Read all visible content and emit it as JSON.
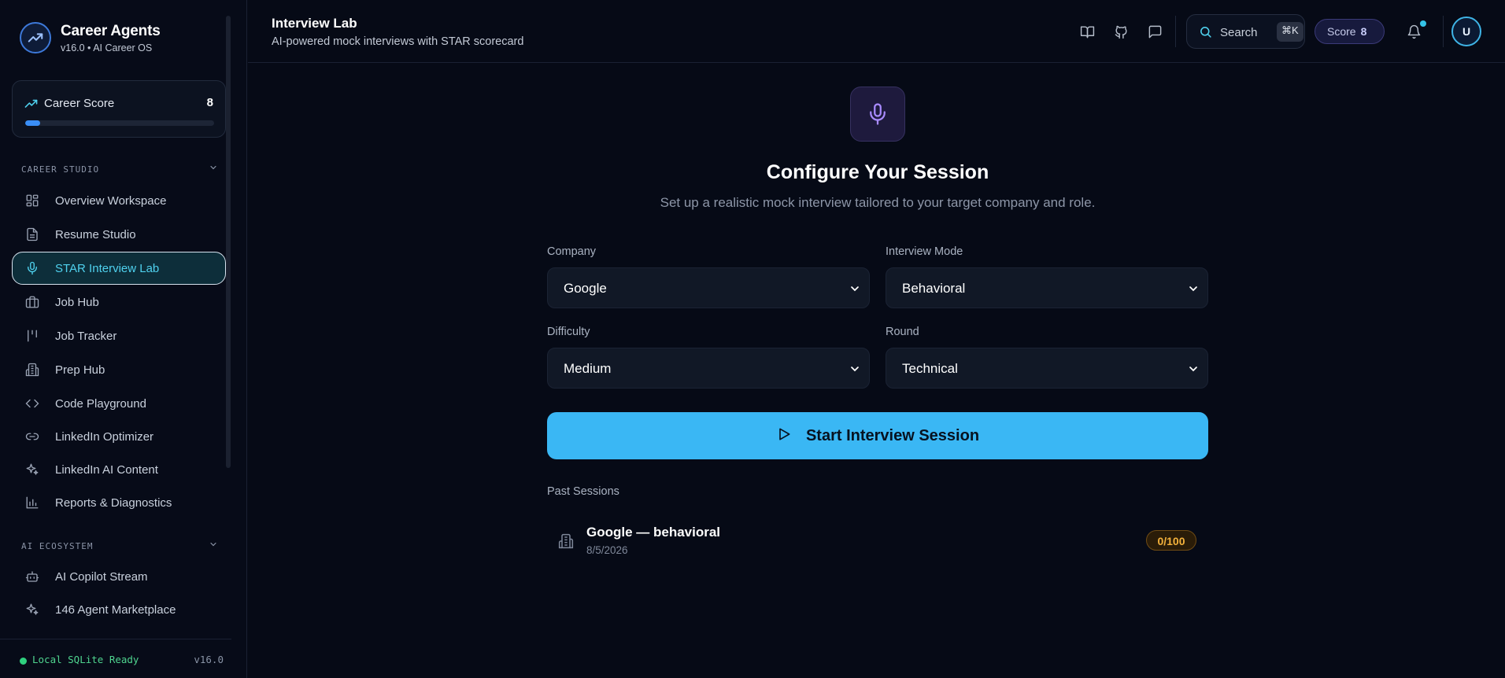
{
  "brand": {
    "name": "Career Agents",
    "subtitle": "v16.0 • AI Career OS"
  },
  "career_score": {
    "label": "Career Score",
    "value": "8",
    "progress": 0.08
  },
  "sections": {
    "studio": "CAREER STUDIO",
    "ecosystem": "AI ECOSYSTEM"
  },
  "nav": {
    "studio": [
      {
        "label": "Overview Workspace",
        "icon": "grid-icon"
      },
      {
        "label": "Resume Studio",
        "icon": "document-icon"
      },
      {
        "label": "STAR Interview Lab",
        "icon": "mic-icon",
        "active": true
      },
      {
        "label": "Job Hub",
        "icon": "briefcase-icon"
      },
      {
        "label": "Job Tracker",
        "icon": "kanban-icon"
      },
      {
        "label": "Prep Hub",
        "icon": "building-icon"
      },
      {
        "label": "Code Playground",
        "icon": "code-icon"
      },
      {
        "label": "LinkedIn Optimizer",
        "icon": "link-icon"
      },
      {
        "label": "LinkedIn AI Content",
        "icon": "sparkle-icon"
      },
      {
        "label": "Reports & Diagnostics",
        "icon": "bar-chart-icon"
      }
    ],
    "ecosystem": [
      {
        "label": "AI Copilot Stream",
        "icon": "bot-icon"
      },
      {
        "label": "146 Agent Marketplace",
        "icon": "sparkle-icon"
      }
    ]
  },
  "footer": {
    "status": "Local SQLite Ready",
    "version": "v16.0"
  },
  "header": {
    "title": "Interview Lab",
    "subtitle": "AI-powered mock interviews with STAR scorecard",
    "search_label": "Search",
    "search_shortcut": "⌘K",
    "score_label": "Score",
    "score_value": "8",
    "avatar_initial": "U"
  },
  "main": {
    "title": "Configure Your Session",
    "subtitle": "Set up a realistic mock interview tailored to your target company and role.",
    "fields": {
      "company": {
        "label": "Company",
        "value": "Google"
      },
      "mode": {
        "label": "Interview Mode",
        "value": "Behavioral"
      },
      "difficulty": {
        "label": "Difficulty",
        "value": "Medium"
      },
      "round": {
        "label": "Round",
        "value": "Technical"
      }
    },
    "start_label": "Start Interview Session",
    "past_title": "Past Sessions",
    "sessions": [
      {
        "name": "Google — behavioral",
        "date": "8/5/2026",
        "score": "0/100"
      }
    ]
  },
  "colors": {
    "accent": "#3ab7f4",
    "active_nav_text": "#4fd1ee",
    "score_badge": "#f3b13b",
    "status_ok": "#2fd07f"
  }
}
